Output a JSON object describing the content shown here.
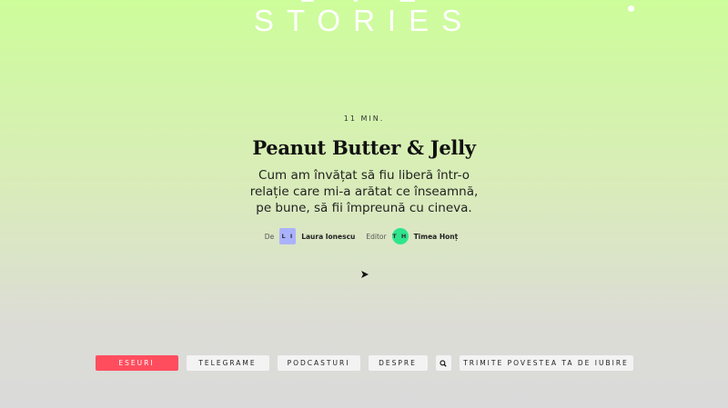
{
  "logo": {
    "line1": "L  V  E",
    "line2": "STORIES"
  },
  "article": {
    "read_time": "11 MIN.",
    "title": "Peanut Butter & Jelly",
    "subtitle": "Cum am învățat să fiu liberă într-o relație care mi-a arătat ce înseamnă, pe bune, să fii împreună cu cineva.",
    "author_prefix": "De",
    "author_initials": "L I",
    "author_name": "Laura Ionescu",
    "editor_prefix": "Editor",
    "editor_initials": "T H",
    "editor_name": "Timea Honț"
  },
  "nav": {
    "items": [
      {
        "label": "ESEURI",
        "active": true
      },
      {
        "label": "TELEGRAME"
      },
      {
        "label": "PODCASTURI"
      },
      {
        "label": "DESPRE"
      },
      {
        "label": "TRIMITE POVESTEA TA DE IUBIRE"
      }
    ],
    "search_icon": "search-icon"
  },
  "colors": {
    "active_nav": "#ff4d5e",
    "author_avatar": "#aab2ff",
    "editor_avatar": "#2ee58d",
    "bg_top": "#cdfd9b"
  }
}
